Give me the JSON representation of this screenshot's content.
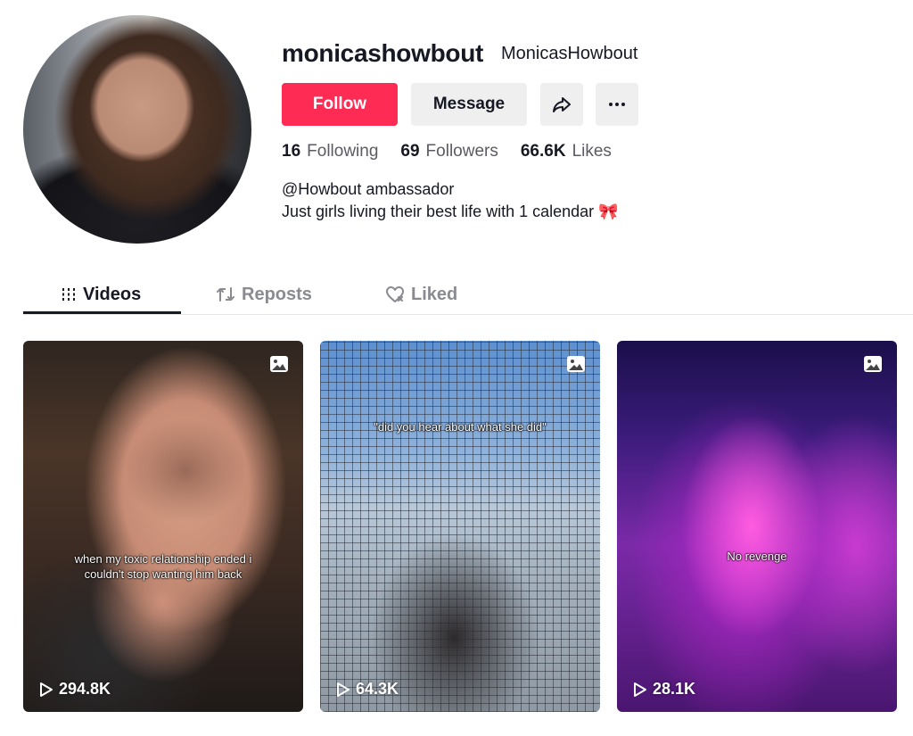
{
  "profile": {
    "username": "monicashowbout",
    "nickname": "MonicasHowbout",
    "bio_line1": "@Howbout ambassador",
    "bio_line2": "Just girls living their best life with 1 calendar 🎀"
  },
  "actions": {
    "follow_label": "Follow",
    "message_label": "Message",
    "share_icon": "share-icon",
    "more_icon": "more-icon"
  },
  "stats": {
    "following_count": "16",
    "following_label": "Following",
    "followers_count": "69",
    "followers_label": "Followers",
    "likes_count": "66.6K",
    "likes_label": "Likes"
  },
  "tabs": [
    {
      "label": "Videos",
      "icon": "grid-icon",
      "active": true
    },
    {
      "label": "Reposts",
      "icon": "repost-icon",
      "active": false
    },
    {
      "label": "Liked",
      "icon": "heart-icon",
      "active": false
    }
  ],
  "videos": [
    {
      "caption": "when my toxic relationship ended i couldn't stop wanting him back",
      "views": "294.8K",
      "type_icon": "photo-icon"
    },
    {
      "caption": "\"did you hear about what she did\"",
      "views": "64.3K",
      "type_icon": "photo-icon"
    },
    {
      "caption": "No revenge",
      "views": "28.1K",
      "type_icon": "photo-icon"
    }
  ],
  "colors": {
    "follow": "#fe2c55",
    "button_gray": "#efeff0",
    "text": "#161823",
    "muted": "#8a8b91"
  }
}
